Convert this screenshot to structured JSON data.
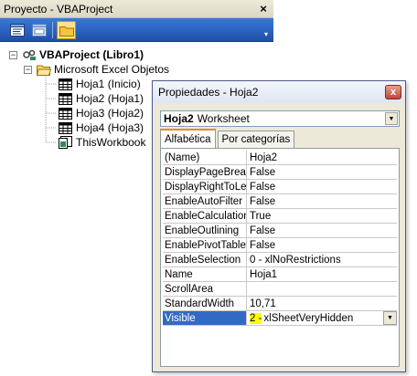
{
  "project_explorer": {
    "title": "Proyecto - VBAProject",
    "close_label": "×",
    "tree": {
      "root_label": "VBAProject (Libro1)",
      "folder_label": "Microsoft Excel Objetos",
      "items": [
        {
          "label": "Hoja1 (Inicio)"
        },
        {
          "label": "Hoja2 (Hoja1)"
        },
        {
          "label": "Hoja3 (Hoja2)"
        },
        {
          "label": "Hoja4 (Hoja3)"
        },
        {
          "label": "ThisWorkbook"
        }
      ]
    }
  },
  "properties": {
    "title": "Propiedades - Hoja2",
    "close_label": "x",
    "object_name": "Hoja2",
    "object_type": "Worksheet",
    "tabs": [
      {
        "label": "Alfabética",
        "active": true
      },
      {
        "label": "Por categorías",
        "active": false
      }
    ],
    "rows": [
      {
        "name": "(Name)",
        "value": "Hoja2"
      },
      {
        "name": "DisplayPageBreaks",
        "value": "False"
      },
      {
        "name": "DisplayRightToLeft",
        "value": "False"
      },
      {
        "name": "EnableAutoFilter",
        "value": "False"
      },
      {
        "name": "EnableCalculation",
        "value": "True"
      },
      {
        "name": "EnableOutlining",
        "value": "False"
      },
      {
        "name": "EnablePivotTable",
        "value": "False"
      },
      {
        "name": "EnableSelection",
        "value": "0 - xlNoRestrictions"
      },
      {
        "name": "Name",
        "value": "Hoja1"
      },
      {
        "name": "ScrollArea",
        "value": ""
      },
      {
        "name": "StandardWidth",
        "value": "10,71"
      }
    ],
    "selected_row": {
      "name": "Visible",
      "value_number": "2 -",
      "value_text": "xlSheetVeryHidden"
    }
  },
  "colors": {
    "selection": "#316ac5",
    "highlight": "#ffff00",
    "toolbar": "#2a5fc4"
  }
}
